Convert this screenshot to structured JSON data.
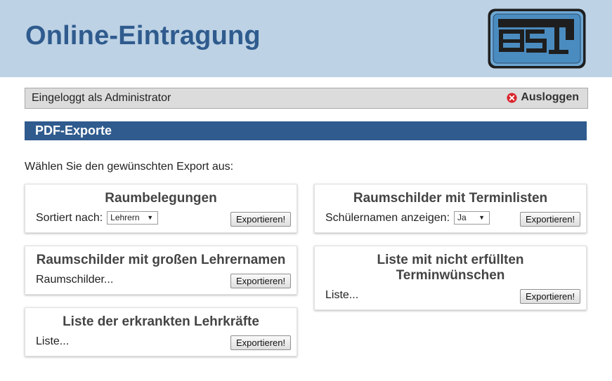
{
  "header": {
    "title": "Online-Eintragung",
    "logo_text": "EST"
  },
  "login": {
    "status": "Eingeloggt als Administrator",
    "logout_label": "Ausloggen"
  },
  "section": {
    "title": "PDF-Exporte"
  },
  "instruction": "Wählen Sie den gewünschten Export aus:",
  "cards": [
    {
      "title": "Raumbelegungen",
      "row_label": "Sortiert nach:",
      "select_value": "Lehrern",
      "button": "Exportieren!"
    },
    {
      "title": "Raumschilder mit Terminlisten",
      "row_label": "Schülernamen anzeigen:",
      "select_value": "Ja",
      "button": "Exportieren!"
    },
    {
      "title": "Raumschilder mit großen Lehrernamen",
      "row_label": "Raumschilder...",
      "button": "Exportieren!"
    },
    {
      "title_line1": "Liste mit nicht erfüllten",
      "title_line2": "Terminwünschen",
      "row_label": "Liste...",
      "button": "Exportieren!"
    },
    {
      "title": "Liste der erkrankten Lehrkräfte",
      "row_label": "Liste...",
      "button": "Exportieren!"
    }
  ],
  "colors": {
    "header_bg": "#bdd2e4",
    "brand_blue": "#2f5b8e",
    "login_bar_bg": "#dcdcdc",
    "logout_icon": "#d8232a"
  },
  "icons": {
    "logo": "est-logo",
    "logout": "close-circle-icon",
    "select_arrow": "triangle-down-icon"
  }
}
